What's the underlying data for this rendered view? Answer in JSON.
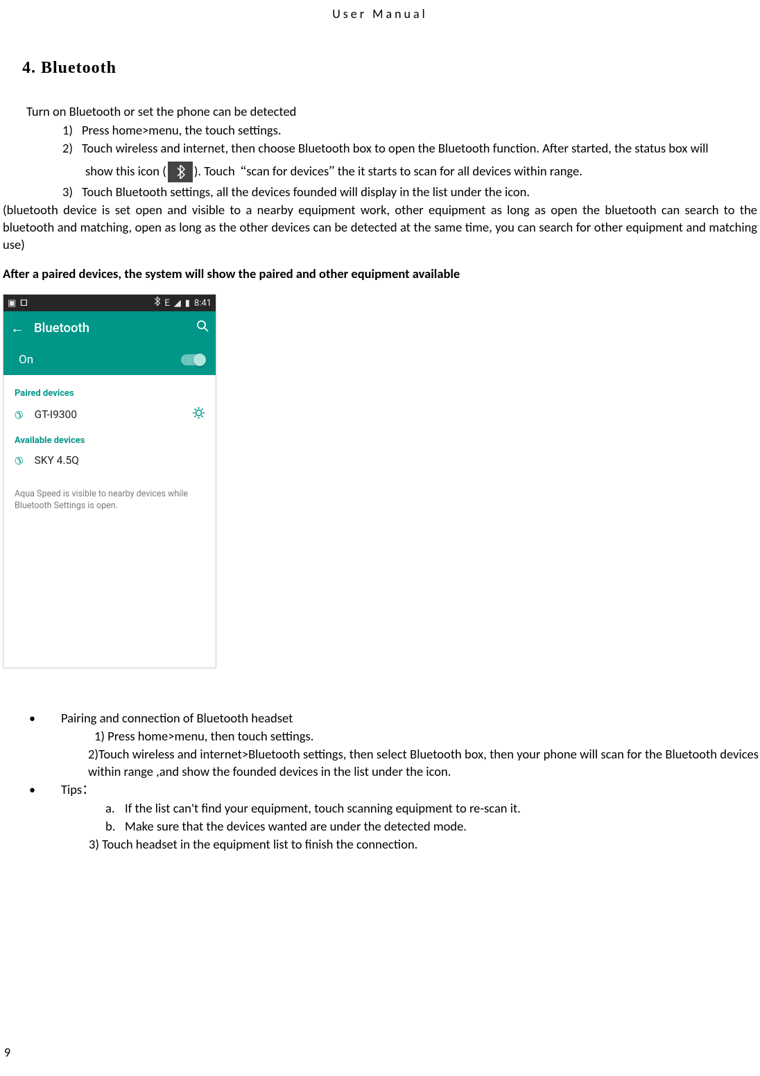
{
  "header": {
    "title": "User  Manual"
  },
  "heading": "4. Bluetooth",
  "intro": "Turn on Bluetooth or set the phone can be detected",
  "list": {
    "i1_num": "1)",
    "i1": "Press home>menu, the touch settings.",
    "i2_num": "2)",
    "i2": "Touch wireless and internet, then choose Bluetooth box to open the Bluetooth function. After started, the status box will",
    "i2b_pre": "show this icon (",
    "i2b_post": "). Touch",
    "i2b_quote_open": "“",
    "i2b_scan": "scan for devices",
    "i2b_quote_close": "”",
    "i2b_tail": "the it starts to scan for all devices within range.",
    "i3_num": "3)",
    "i3": "Touch Bluetooth settings, all the devices founded will display in the list under the icon."
  },
  "para": "(bluetooth device is set open and visible to a nearby equipment work, other equipment as long as open the bluetooth can search to the bluetooth and matching, open as long as the other devices can be detected at the same time, you can search for other equipment and matching use)",
  "after_paired": "After a paired devices, the system will show the paired and other equipment available",
  "screenshot": {
    "status": {
      "bt_icon": "✱",
      "net": "E",
      "sig": "◢",
      "batt": "▮",
      "time": "8:41"
    },
    "appbar": {
      "back": "←",
      "title": "Bluetooth",
      "search": "🔍"
    },
    "toggle": {
      "label": "On"
    },
    "paired_label": "Paired devices",
    "paired_device": "GT-I9300",
    "gear": "✿",
    "avail_label": "Available devices",
    "avail_device": "SKY 4.5Q",
    "note": "Aqua Speed is visible to nearby devices while Bluetooth Settings is open."
  },
  "section2": {
    "bul1": "Pairing and connection of Bluetooth headset",
    "s1": "1) Press home>menu, then touch settings.",
    "s2": "2)Touch wireless and internet>Bluetooth settings, then select Bluetooth box, then your phone will scan for the Bluetooth devices within range ,and show the founded devices in the list under the icon.",
    "bul2": "Tips",
    "colon": "：",
    "a_lt": "a.",
    "a": "If the list can't find your equipment, touch scanning equipment to re-scan it.",
    "b_lt": "b.",
    "b": "Make sure that the devices wanted are under the detected mode.",
    "s3": "3) Touch headset in the equipment list to finish the connection."
  },
  "pageno": "9"
}
